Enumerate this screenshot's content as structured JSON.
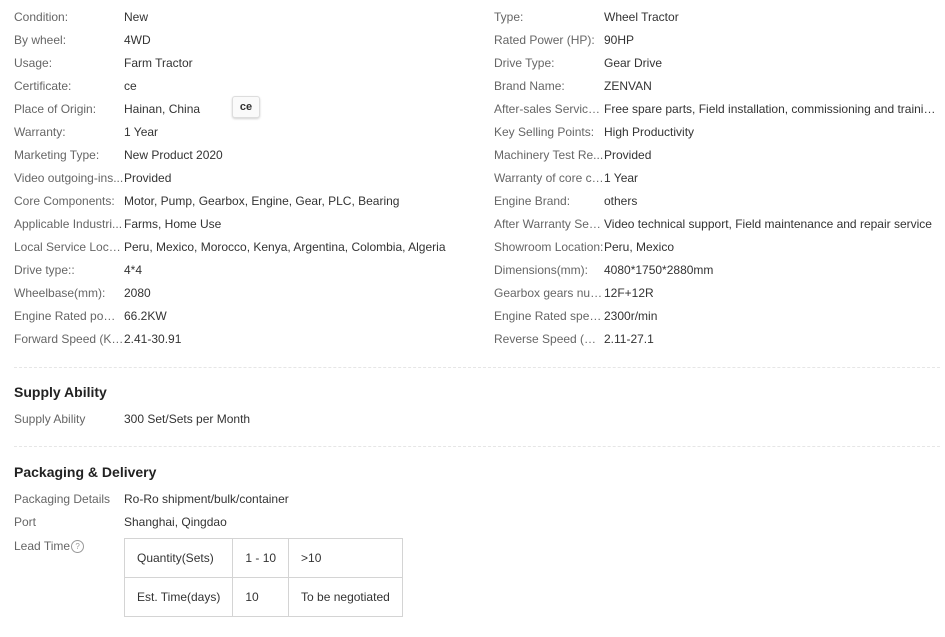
{
  "attributes_left": [
    {
      "label": "Condition:",
      "value": "New"
    },
    {
      "label": "By wheel:",
      "value": "4WD"
    },
    {
      "label": "Usage:",
      "value": "Farm Tractor"
    },
    {
      "label": "Certificate:",
      "value": "ce"
    },
    {
      "label": "Place of Origin:",
      "value": "Hainan, China"
    },
    {
      "label": "Warranty:",
      "value": "1 Year"
    },
    {
      "label": "Marketing Type:",
      "value": "New Product 2020"
    },
    {
      "label": "Video outgoing-ins...",
      "value": "Provided"
    },
    {
      "label": "Core Components:",
      "value": "Motor, Pump, Gearbox, Engine, Gear, PLC, Bearing"
    },
    {
      "label": "Applicable Industri...",
      "value": "Farms, Home Use"
    },
    {
      "label": "Local Service Locat...",
      "value": "Peru, Mexico, Morocco, Kenya, Argentina, Colombia, Algeria"
    },
    {
      "label": "Drive type::",
      "value": "4*4"
    },
    {
      "label": "Wheelbase(mm):",
      "value": "2080"
    },
    {
      "label": "Engine Rated power:",
      "value": "66.2KW"
    },
    {
      "label": "Forward Speed (Kw...",
      "value": "2.41-30.91"
    }
  ],
  "attributes_right": [
    {
      "label": "Type:",
      "value": "Wheel Tractor"
    },
    {
      "label": "Rated Power (HP):",
      "value": "90HP"
    },
    {
      "label": "Drive Type:",
      "value": "Gear Drive"
    },
    {
      "label": "Brand Name:",
      "value": "ZENVAN"
    },
    {
      "label": "After-sales Service ...",
      "value": "Free spare parts, Field installation, commissioning and trainin..."
    },
    {
      "label": "Key Selling Points:",
      "value": "High Productivity"
    },
    {
      "label": "Machinery Test Re...",
      "value": "Provided"
    },
    {
      "label": "Warranty of core co...",
      "value": "1 Year"
    },
    {
      "label": "Engine Brand:",
      "value": "others"
    },
    {
      "label": "After Warranty Serv...",
      "value": "Video technical support, Field maintenance and repair service"
    },
    {
      "label": "Showroom Location:",
      "value": "Peru, Mexico"
    },
    {
      "label": "Dimensions(mm):",
      "value": "4080*1750*2880mm"
    },
    {
      "label": "Gearbox gears num...",
      "value": "12F+12R"
    },
    {
      "label": "Engine Rated speed:",
      "value": "2300r/min"
    },
    {
      "label": "Reverse Speed (Kw...",
      "value": "2.11-27.1"
    }
  ],
  "certificate_badge": "ce",
  "supply": {
    "title": "Supply Ability",
    "label": "Supply Ability",
    "value": "300 Set/Sets per Month"
  },
  "packaging": {
    "title": "Packaging & Delivery",
    "details_label": "Packaging Details",
    "details_value": "Ro-Ro shipment/bulk/container",
    "port_label": "Port",
    "port_value": "Shanghai, Qingdao",
    "lead_time_label": "Lead Time",
    "help_icon": "?",
    "lead_table": [
      [
        "Quantity(Sets)",
        "1 - 10",
        ">10"
      ],
      [
        "Est. Time(days)",
        "10",
        "To be negotiated"
      ]
    ]
  }
}
